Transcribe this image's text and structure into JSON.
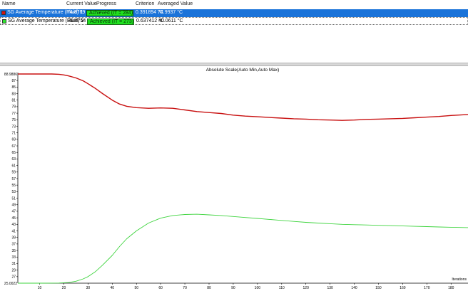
{
  "table": {
    "headers": [
      "Name",
      "Current Value",
      "Progress",
      "Criterion",
      "Averaged Value"
    ],
    "rows": [
      {
        "name": "SG Average Temperature (Fluid) 1",
        "current_value": "74.8769 °C",
        "progress": "Achieved (IT = 284)",
        "criterion": "0.391894 °C",
        "averaged_value": "74.9937 °C",
        "color": "#d21414",
        "selected": true
      },
      {
        "name": "SG Average Temperature (Fluid) 2",
        "current_value": "39.8754 °C",
        "progress": "Achieved (IT = 273)",
        "criterion": "0.637412 °C",
        "averaged_value": "40.0611 °C",
        "color": "#2ee62e",
        "selected": false
      }
    ]
  },
  "chart": {
    "title": "Absolute Scale(Auto Min,Auto Max)",
    "x_label": "Iterations",
    "y_max_label": "88.9886",
    "y_min_label": "25.0022"
  },
  "chart_data": {
    "type": "line",
    "title": "Absolute Scale(Auto Min,Auto Max)",
    "xlabel": "Iterations",
    "ylabel": "",
    "xlim": [
      1,
      187
    ],
    "ylim": [
      25.0022,
      88.9886
    ],
    "x_ticks": [
      10,
      20,
      30,
      40,
      50,
      60,
      70,
      80,
      90,
      100,
      110,
      120,
      130,
      140,
      150,
      160,
      170,
      180
    ],
    "y_ticks": [
      27,
      29,
      31,
      33,
      35,
      37,
      39,
      41,
      43,
      45,
      47,
      49,
      51,
      53,
      55,
      57,
      59,
      61,
      63,
      65,
      67,
      69,
      71,
      73,
      75,
      77,
      79,
      81,
      83,
      85,
      87
    ],
    "series": [
      {
        "name": "SG Average Temperature (Fluid) 1",
        "color": "#c81010",
        "x": [
          1,
          5,
          10,
          15,
          18,
          20,
          22,
          25,
          28,
          30,
          33,
          36,
          40,
          43,
          46,
          50,
          55,
          60,
          65,
          70,
          75,
          80,
          85,
          90,
          95,
          100,
          105,
          110,
          115,
          120,
          125,
          130,
          135,
          140,
          145,
          150,
          155,
          160,
          165,
          170,
          175,
          180,
          187
        ],
        "values": [
          88.99,
          88.99,
          88.99,
          88.98,
          88.9,
          88.7,
          88.4,
          87.8,
          86.9,
          86.0,
          84.6,
          83.0,
          81.0,
          79.8,
          79.1,
          78.7,
          78.5,
          78.6,
          78.5,
          78.0,
          77.5,
          77.2,
          76.9,
          76.4,
          76.1,
          75.9,
          75.7,
          75.5,
          75.3,
          75.2,
          75.0,
          74.9,
          74.8,
          74.9,
          75.1,
          75.2,
          75.3,
          75.4,
          75.6,
          75.8,
          76.0,
          76.3,
          76.6
        ]
      },
      {
        "name": "SG Average Temperature (Fluid) 2",
        "color": "#3ed43e",
        "x": [
          1,
          10,
          18,
          22,
          25,
          28,
          30,
          33,
          36,
          40,
          43,
          46,
          50,
          55,
          60,
          65,
          70,
          75,
          80,
          85,
          90,
          95,
          100,
          105,
          110,
          115,
          120,
          125,
          130,
          135,
          140,
          145,
          150,
          155,
          160,
          165,
          170,
          175,
          180,
          187
        ],
        "values": [
          25.0,
          25.0,
          25.05,
          25.2,
          25.6,
          26.3,
          27.0,
          28.5,
          30.5,
          33.5,
          36.2,
          38.6,
          41.0,
          43.4,
          44.9,
          45.7,
          46.0,
          46.1,
          45.9,
          45.7,
          45.4,
          45.1,
          44.8,
          44.5,
          44.2,
          43.9,
          43.6,
          43.4,
          43.2,
          43.0,
          42.9,
          42.8,
          42.7,
          42.6,
          42.5,
          42.4,
          42.3,
          42.2,
          42.1,
          42.0
        ]
      }
    ]
  }
}
